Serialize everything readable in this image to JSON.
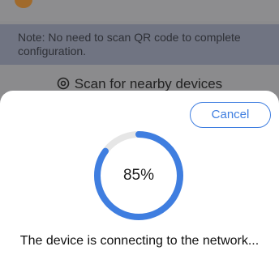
{
  "background": {
    "note": "Note: No need to scan QR code to complete configuration.",
    "scan_label": "Scan for nearby devices"
  },
  "sheet": {
    "cancel_label": "Cancel",
    "progress_value": 85,
    "progress_label": "85%",
    "status": "The device is connecting to the network..."
  },
  "colors": {
    "accent": "#3f7ee0",
    "track": "#e6e6e6"
  }
}
